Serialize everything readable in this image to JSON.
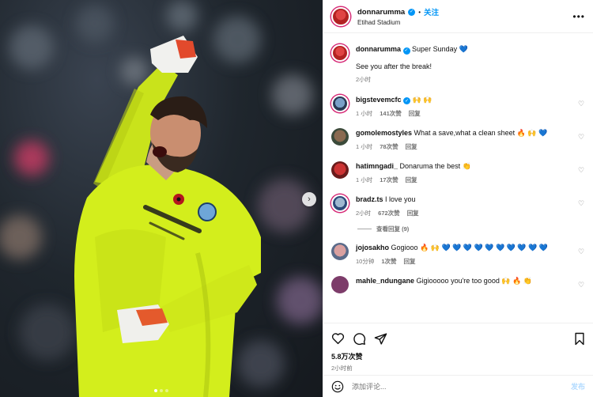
{
  "header": {
    "username": "donnarumma",
    "follow_label": "关注",
    "location": "Etihad Stadium",
    "dot": "•"
  },
  "caption": {
    "username": "donnarumma",
    "text": "Super Sunday 💙",
    "text2": "See you after the break!",
    "time": "2小时"
  },
  "comments": [
    {
      "username": "bigstevemcfc",
      "verified": true,
      "text": "🙌 🙌",
      "time": "1 小时",
      "likes": "141次赞",
      "reply": "回复"
    },
    {
      "username": "gomolemostyles",
      "verified": false,
      "text": "What a save,what a clean sheet 🔥 🙌 💙",
      "time": "1 小时",
      "likes": "78次赞",
      "reply": "回复"
    },
    {
      "username": "hatimngadi_",
      "verified": false,
      "text": "Donaruma the best 👏",
      "time": "1 小时",
      "likes": "17次赞",
      "reply": "回复"
    },
    {
      "username": "bradz.ts",
      "verified": false,
      "text": "I love you",
      "time": "2小时",
      "likes": "672次赞",
      "reply": "回复"
    },
    {
      "username": "jojosakho",
      "verified": false,
      "text": "Gogiooo 🔥 🙌 💙 💙 💙 💙 💙 💙 💙 💙 💙 💙",
      "time": "10分钟",
      "likes": "1次赞",
      "reply": "回复"
    },
    {
      "username": "mahle_ndungane",
      "verified": false,
      "text": "Gigiooooo you're too good 🙌 🔥 👏",
      "time": "",
      "likes": "",
      "reply": ""
    }
  ],
  "view_replies": "查看回复 (9)",
  "likes_total": "5.8万次赞",
  "posted_time": "2小时前",
  "comment_box": {
    "placeholder": "添加评论...",
    "post_label": "发布"
  },
  "colors": {
    "accent": "#0095f6",
    "kit": "#d4f01c",
    "ring": "#d62976"
  },
  "icons": [
    "heart-icon",
    "comment-icon",
    "share-icon",
    "bookmark-icon",
    "emoji-icon",
    "more-icon",
    "chevron-right-icon",
    "verified-icon"
  ]
}
